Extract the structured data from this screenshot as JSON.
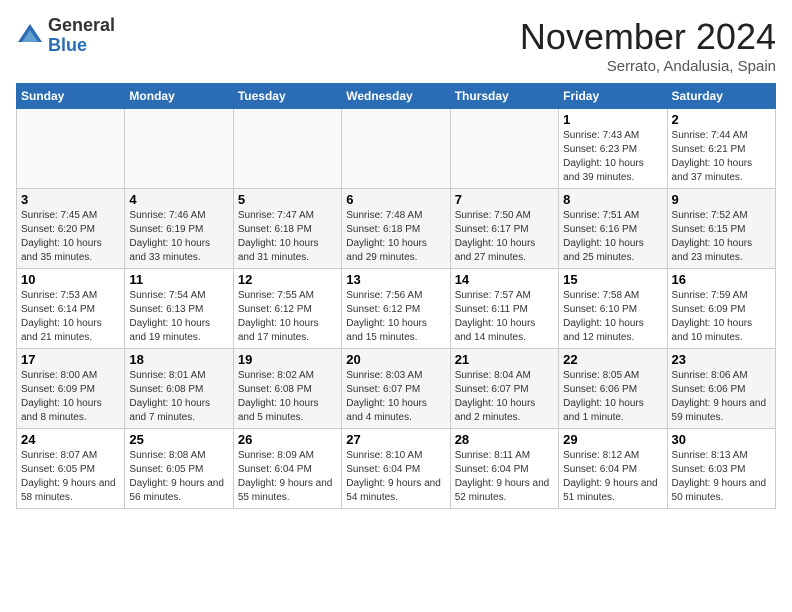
{
  "logo": {
    "general": "General",
    "blue": "Blue"
  },
  "title": "November 2024",
  "location": "Serrato, Andalusia, Spain",
  "days_of_week": [
    "Sunday",
    "Monday",
    "Tuesday",
    "Wednesday",
    "Thursday",
    "Friday",
    "Saturday"
  ],
  "weeks": [
    [
      {
        "day": "",
        "info": ""
      },
      {
        "day": "",
        "info": ""
      },
      {
        "day": "",
        "info": ""
      },
      {
        "day": "",
        "info": ""
      },
      {
        "day": "",
        "info": ""
      },
      {
        "day": "1",
        "info": "Sunrise: 7:43 AM\nSunset: 6:23 PM\nDaylight: 10 hours and 39 minutes."
      },
      {
        "day": "2",
        "info": "Sunrise: 7:44 AM\nSunset: 6:21 PM\nDaylight: 10 hours and 37 minutes."
      }
    ],
    [
      {
        "day": "3",
        "info": "Sunrise: 7:45 AM\nSunset: 6:20 PM\nDaylight: 10 hours and 35 minutes."
      },
      {
        "day": "4",
        "info": "Sunrise: 7:46 AM\nSunset: 6:19 PM\nDaylight: 10 hours and 33 minutes."
      },
      {
        "day": "5",
        "info": "Sunrise: 7:47 AM\nSunset: 6:18 PM\nDaylight: 10 hours and 31 minutes."
      },
      {
        "day": "6",
        "info": "Sunrise: 7:48 AM\nSunset: 6:18 PM\nDaylight: 10 hours and 29 minutes."
      },
      {
        "day": "7",
        "info": "Sunrise: 7:50 AM\nSunset: 6:17 PM\nDaylight: 10 hours and 27 minutes."
      },
      {
        "day": "8",
        "info": "Sunrise: 7:51 AM\nSunset: 6:16 PM\nDaylight: 10 hours and 25 minutes."
      },
      {
        "day": "9",
        "info": "Sunrise: 7:52 AM\nSunset: 6:15 PM\nDaylight: 10 hours and 23 minutes."
      }
    ],
    [
      {
        "day": "10",
        "info": "Sunrise: 7:53 AM\nSunset: 6:14 PM\nDaylight: 10 hours and 21 minutes."
      },
      {
        "day": "11",
        "info": "Sunrise: 7:54 AM\nSunset: 6:13 PM\nDaylight: 10 hours and 19 minutes."
      },
      {
        "day": "12",
        "info": "Sunrise: 7:55 AM\nSunset: 6:12 PM\nDaylight: 10 hours and 17 minutes."
      },
      {
        "day": "13",
        "info": "Sunrise: 7:56 AM\nSunset: 6:12 PM\nDaylight: 10 hours and 15 minutes."
      },
      {
        "day": "14",
        "info": "Sunrise: 7:57 AM\nSunset: 6:11 PM\nDaylight: 10 hours and 14 minutes."
      },
      {
        "day": "15",
        "info": "Sunrise: 7:58 AM\nSunset: 6:10 PM\nDaylight: 10 hours and 12 minutes."
      },
      {
        "day": "16",
        "info": "Sunrise: 7:59 AM\nSunset: 6:09 PM\nDaylight: 10 hours and 10 minutes."
      }
    ],
    [
      {
        "day": "17",
        "info": "Sunrise: 8:00 AM\nSunset: 6:09 PM\nDaylight: 10 hours and 8 minutes."
      },
      {
        "day": "18",
        "info": "Sunrise: 8:01 AM\nSunset: 6:08 PM\nDaylight: 10 hours and 7 minutes."
      },
      {
        "day": "19",
        "info": "Sunrise: 8:02 AM\nSunset: 6:08 PM\nDaylight: 10 hours and 5 minutes."
      },
      {
        "day": "20",
        "info": "Sunrise: 8:03 AM\nSunset: 6:07 PM\nDaylight: 10 hours and 4 minutes."
      },
      {
        "day": "21",
        "info": "Sunrise: 8:04 AM\nSunset: 6:07 PM\nDaylight: 10 hours and 2 minutes."
      },
      {
        "day": "22",
        "info": "Sunrise: 8:05 AM\nSunset: 6:06 PM\nDaylight: 10 hours and 1 minute."
      },
      {
        "day": "23",
        "info": "Sunrise: 8:06 AM\nSunset: 6:06 PM\nDaylight: 9 hours and 59 minutes."
      }
    ],
    [
      {
        "day": "24",
        "info": "Sunrise: 8:07 AM\nSunset: 6:05 PM\nDaylight: 9 hours and 58 minutes."
      },
      {
        "day": "25",
        "info": "Sunrise: 8:08 AM\nSunset: 6:05 PM\nDaylight: 9 hours and 56 minutes."
      },
      {
        "day": "26",
        "info": "Sunrise: 8:09 AM\nSunset: 6:04 PM\nDaylight: 9 hours and 55 minutes."
      },
      {
        "day": "27",
        "info": "Sunrise: 8:10 AM\nSunset: 6:04 PM\nDaylight: 9 hours and 54 minutes."
      },
      {
        "day": "28",
        "info": "Sunrise: 8:11 AM\nSunset: 6:04 PM\nDaylight: 9 hours and 52 minutes."
      },
      {
        "day": "29",
        "info": "Sunrise: 8:12 AM\nSunset: 6:04 PM\nDaylight: 9 hours and 51 minutes."
      },
      {
        "day": "30",
        "info": "Sunrise: 8:13 AM\nSunset: 6:03 PM\nDaylight: 9 hours and 50 minutes."
      }
    ]
  ]
}
